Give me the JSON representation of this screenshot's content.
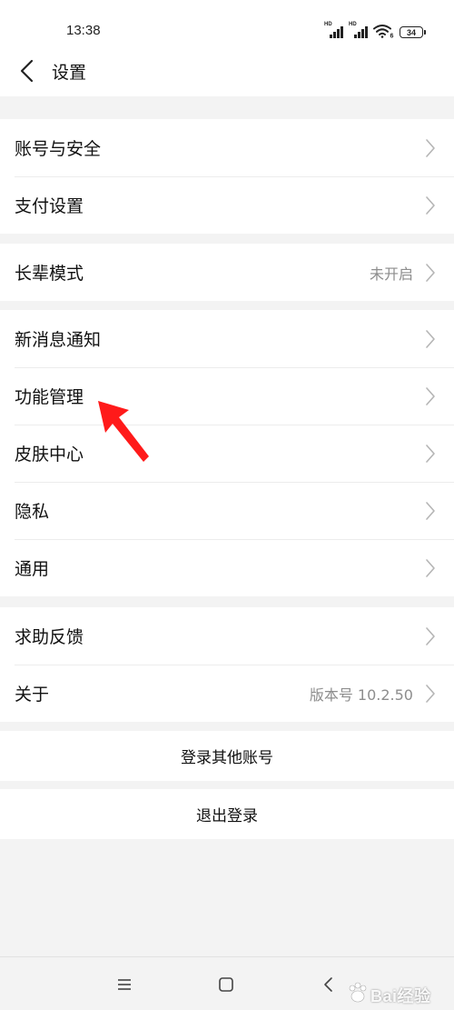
{
  "status_bar": {
    "time": "13:38",
    "signal_1_label": "HD",
    "signal_2_label": "HD",
    "wifi_label": "6",
    "battery_level": "34"
  },
  "header": {
    "title": "设置",
    "back_icon": "chevron-left-icon"
  },
  "groups": [
    {
      "items": [
        {
          "label": "账号与安全",
          "value": ""
        },
        {
          "label": "支付设置",
          "value": ""
        }
      ]
    },
    {
      "items": [
        {
          "label": "长辈模式",
          "value": "未开启"
        }
      ]
    },
    {
      "items": [
        {
          "label": "新消息通知",
          "value": ""
        },
        {
          "label": "功能管理",
          "value": ""
        },
        {
          "label": "皮肤中心",
          "value": ""
        },
        {
          "label": "隐私",
          "value": ""
        },
        {
          "label": "通用",
          "value": ""
        }
      ]
    },
    {
      "items": [
        {
          "label": "求助反馈",
          "value": ""
        },
        {
          "label": "关于",
          "value": "版本号 10.2.50"
        }
      ]
    }
  ],
  "actions": {
    "login_other": "登录其他账号",
    "logout": "退出登录"
  },
  "nav_bar": {
    "menu_icon": "menu-icon",
    "home_icon": "home-icon",
    "back_icon": "back-triangle-icon"
  },
  "watermark": {
    "text": "Bai经验"
  },
  "annotation": {
    "type": "red-arrow",
    "color": "#ff1a1a",
    "points_to": "功能管理"
  },
  "colors": {
    "background": "#f3f3f3",
    "card": "#ffffff",
    "secondary_text": "#8d8d8d",
    "chevron": "#b5b5b5"
  }
}
